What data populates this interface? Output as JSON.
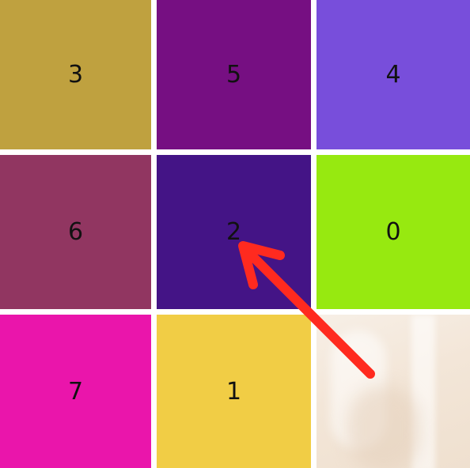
{
  "tiles": [
    {
      "label": "3",
      "color": "#bfa13f"
    },
    {
      "label": "5",
      "color": "#760f82"
    },
    {
      "label": "4",
      "color": "#784edb"
    },
    {
      "label": "6",
      "color": "#913661"
    },
    {
      "label": "2",
      "color": "#441486"
    },
    {
      "label": "0",
      "color": "#97e910"
    },
    {
      "label": "7",
      "color": "#ea15ab"
    },
    {
      "label": "1",
      "color": "#f1cd45"
    }
  ],
  "empty_cell": {
    "style": "blurred photo background"
  },
  "annotation": {
    "type": "arrow",
    "color": "#ff2a1f",
    "points_to": "tile 2"
  }
}
